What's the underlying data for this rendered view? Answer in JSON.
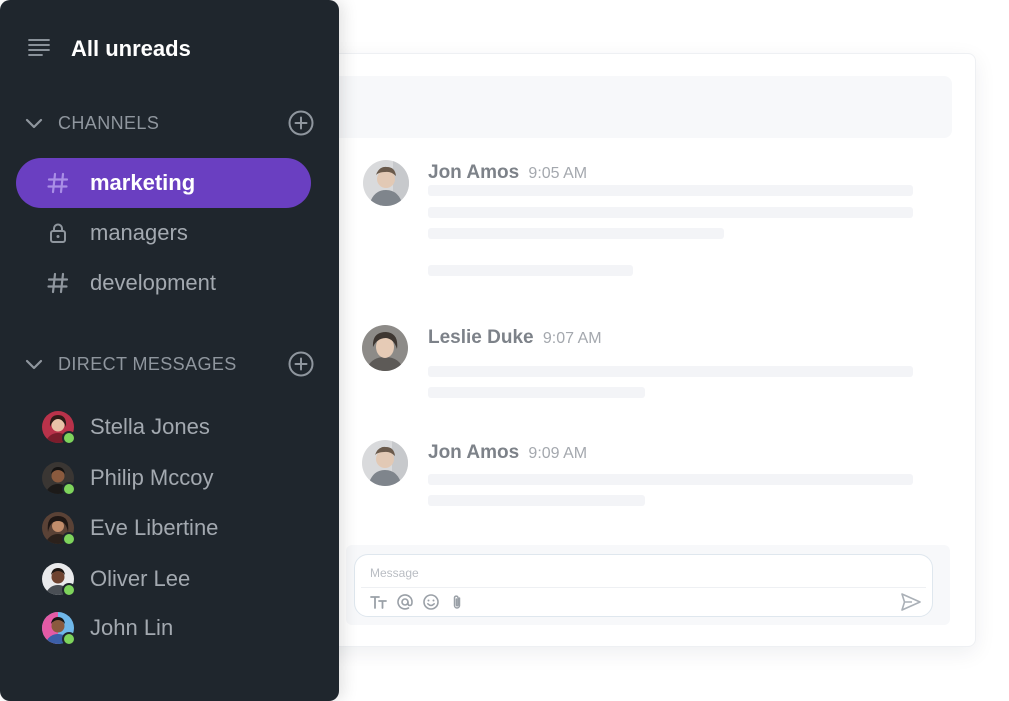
{
  "sidebar": {
    "title": "All unreads",
    "channels_header": "CHANNELS",
    "channels": [
      {
        "label": "marketing",
        "icon": "hash-icon",
        "active": true
      },
      {
        "label": "managers",
        "icon": "lock-icon",
        "active": false
      },
      {
        "label": "development",
        "icon": "hash-icon",
        "active": false
      }
    ],
    "dm_header": "DIRECT MESSAGES",
    "direct_messages": [
      {
        "name": "Stella Jones",
        "status": "online"
      },
      {
        "name": "Philip Mccoy",
        "status": "online"
      },
      {
        "name": "Eve Libertine",
        "status": "online"
      },
      {
        "name": "Oliver Lee",
        "status": "online"
      },
      {
        "name": "John Lin",
        "status": "online"
      }
    ]
  },
  "messages": [
    {
      "author": "Jon Amos",
      "time": "9:05 AM"
    },
    {
      "author": "Leslie Duke",
      "time": "9:07 AM"
    },
    {
      "author": "Jon Amos",
      "time": "9:09 AM"
    }
  ],
  "composer": {
    "placeholder": "Message",
    "tools": [
      "text-format-icon",
      "mention-icon",
      "emoji-icon",
      "attachment-icon"
    ],
    "send_icon": "send-icon"
  },
  "colors": {
    "sidebar_bg": "#1f262d",
    "active_channel": "#6a3fc1",
    "presence": "#7ed45c"
  }
}
